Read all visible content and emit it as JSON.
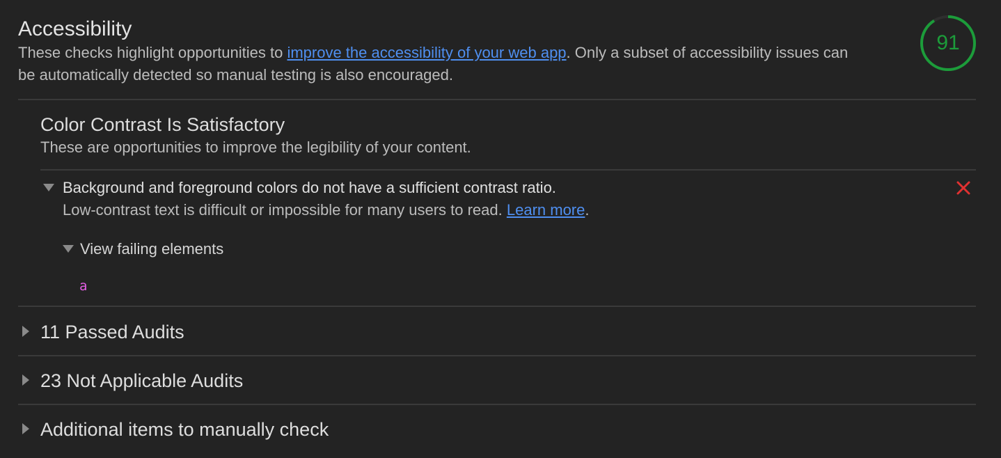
{
  "category": {
    "title": "Accessibility",
    "desc_before": "These checks highlight opportunities to ",
    "desc_link": "improve the accessibility of your web app",
    "desc_after": ". Only a subset of accessibility issues can be automatically detected so manual testing is also encouraged.",
    "score": "91",
    "score_color": "#1c9c3a",
    "score_fraction": 0.91
  },
  "group": {
    "title": "Color Contrast Is Satisfactory",
    "desc": "These are opportunities to improve the legibility of your content."
  },
  "audit": {
    "title": "Background and foreground colors do not have a sufficient contrast ratio.",
    "desc": "Low-contrast text is difficult or impossible for many users to read. ",
    "learn_more": "Learn more",
    "desc_end": ".",
    "status_icon": "fail-x-icon",
    "status_color": "#e03131",
    "details_label": "View failing elements",
    "failing_node": "a"
  },
  "collapsed_sections": [
    {
      "label": "11 Passed Audits"
    },
    {
      "label": "23 Not Applicable Audits"
    },
    {
      "label": "Additional items to manually check"
    }
  ]
}
